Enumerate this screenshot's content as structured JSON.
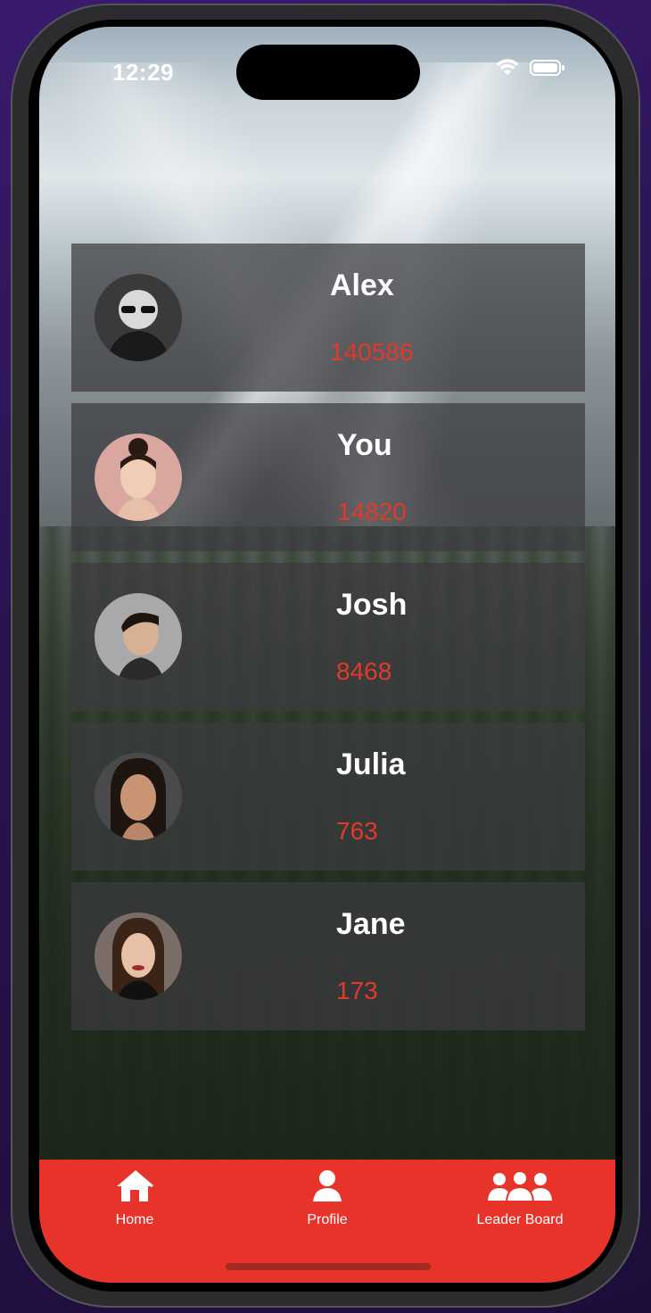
{
  "status_bar": {
    "time": "12:29"
  },
  "leaderboard": [
    {
      "name": "Alex",
      "score": "140586",
      "avatar": "older-man-avatar"
    },
    {
      "name": "You",
      "score": "14820",
      "avatar": "young-woman-avatar"
    },
    {
      "name": "Josh",
      "score": "8468",
      "avatar": "young-man-avatar"
    },
    {
      "name": "Julia",
      "score": "763",
      "avatar": "woman-avatar"
    },
    {
      "name": "Jane",
      "score": "173",
      "avatar": "woman-avatar-2"
    }
  ],
  "tabbar": {
    "home_label": "Home",
    "profile_label": "Profile",
    "leaderboard_label": "Leader Board"
  },
  "colors": {
    "accent": "#e8332a",
    "score_text": "#e23a2a",
    "card_bg": "rgba(60,60,62,0.72)"
  }
}
